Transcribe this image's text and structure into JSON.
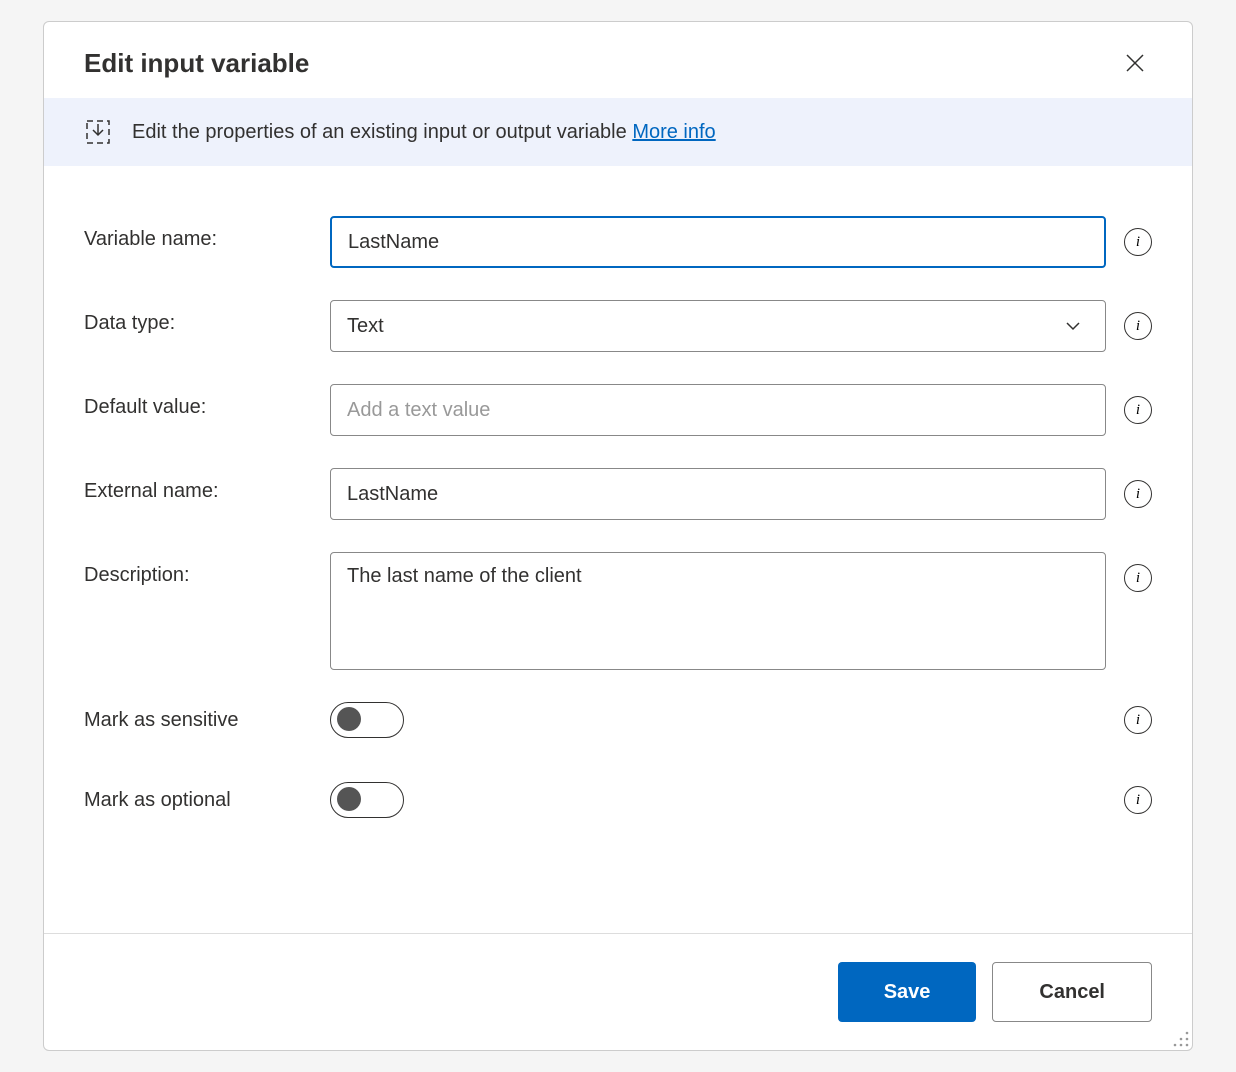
{
  "dialog": {
    "title": "Edit input variable"
  },
  "banner": {
    "text": "Edit the properties of an existing input or output variable ",
    "link_text": "More info"
  },
  "form": {
    "variable_name": {
      "label": "Variable name:",
      "value": "LastName"
    },
    "data_type": {
      "label": "Data type:",
      "value": "Text"
    },
    "default_value": {
      "label": "Default value:",
      "value": "",
      "placeholder": "Add a text value"
    },
    "external_name": {
      "label": "External name:",
      "value": "LastName"
    },
    "description": {
      "label": "Description:",
      "value": "The last name of the client"
    },
    "mark_sensitive": {
      "label": "Mark as sensitive",
      "value": false
    },
    "mark_optional": {
      "label": "Mark as optional",
      "value": false
    }
  },
  "footer": {
    "save_label": "Save",
    "cancel_label": "Cancel"
  }
}
